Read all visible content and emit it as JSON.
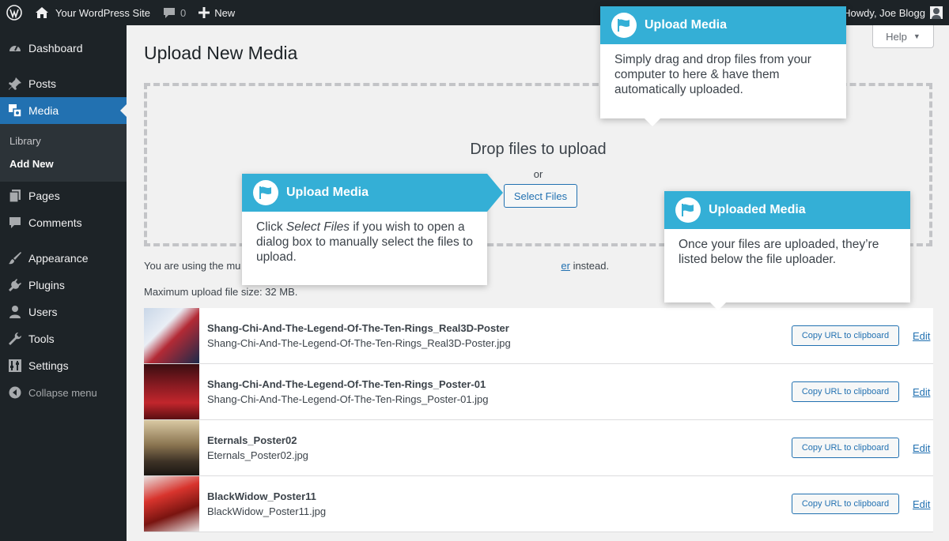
{
  "adminbar": {
    "site_name": "Your WordPress Site",
    "comments_count": "0",
    "new_label": "New",
    "howdy": "Howdy, Joe Blogg"
  },
  "sidebar": {
    "items": [
      {
        "label": "Dashboard",
        "icon": "dashboard-icon"
      },
      {
        "label": "Posts",
        "icon": "pin-icon"
      },
      {
        "label": "Media",
        "icon": "media-icon"
      },
      {
        "label": "Pages",
        "icon": "pages-icon"
      },
      {
        "label": "Comments",
        "icon": "comment-icon"
      },
      {
        "label": "Appearance",
        "icon": "brush-icon"
      },
      {
        "label": "Plugins",
        "icon": "plug-icon"
      },
      {
        "label": "Users",
        "icon": "user-icon"
      },
      {
        "label": "Tools",
        "icon": "wrench-icon"
      },
      {
        "label": "Settings",
        "icon": "sliders-icon"
      }
    ],
    "submenu": [
      "Library",
      "Add New"
    ],
    "collapse": "Collapse menu"
  },
  "main": {
    "title": "Upload New Media",
    "help": "Help",
    "drop_title": "Drop files to upload",
    "or": "or",
    "select_files": "Select Files",
    "info_prefix": "You are using the mu",
    "info_link": "er",
    "info_suffix": " instead.",
    "max_size": "Maximum upload file size: 32 MB."
  },
  "media_items": [
    {
      "title": "Shang-Chi-And-The-Legend-Of-The-Ten-Rings_Real3D-Poster",
      "file": "Shang-Chi-And-The-Legend-Of-The-Ten-Rings_Real3D-Poster.jpg",
      "copy": "Copy URL to clipboard",
      "edit": "Edit"
    },
    {
      "title": "Shang-Chi-And-The-Legend-Of-The-Ten-Rings_Poster-01",
      "file": "Shang-Chi-And-The-Legend-Of-The-Ten-Rings_Poster-01.jpg",
      "copy": "Copy URL to clipboard",
      "edit": "Edit"
    },
    {
      "title": "Eternals_Poster02",
      "file": "Eternals_Poster02.jpg",
      "copy": "Copy URL to clipboard",
      "edit": "Edit"
    },
    {
      "title": "BlackWidow_Poster11",
      "file": "BlackWidow_Poster11.jpg",
      "copy": "Copy URL to clipboard",
      "edit": "Edit"
    }
  ],
  "tooltips": {
    "tip1": {
      "title": "Upload Media",
      "body": "Simply drag and drop files from your computer to here & have them automatically uploaded."
    },
    "tip2": {
      "title": "Upload Media",
      "body_pre": "Click ",
      "body_em": "Select Files",
      "body_post": " if you wish to open a dialog box to manually select the files to upload."
    },
    "tip3": {
      "title": "Uploaded Media",
      "body": "Once your files are uploaded, they’re listed below the file uploader."
    }
  },
  "colors": {
    "admin_dark": "#1d2327",
    "accent": "#2271b1",
    "tooltip_head": "#34afd6"
  }
}
